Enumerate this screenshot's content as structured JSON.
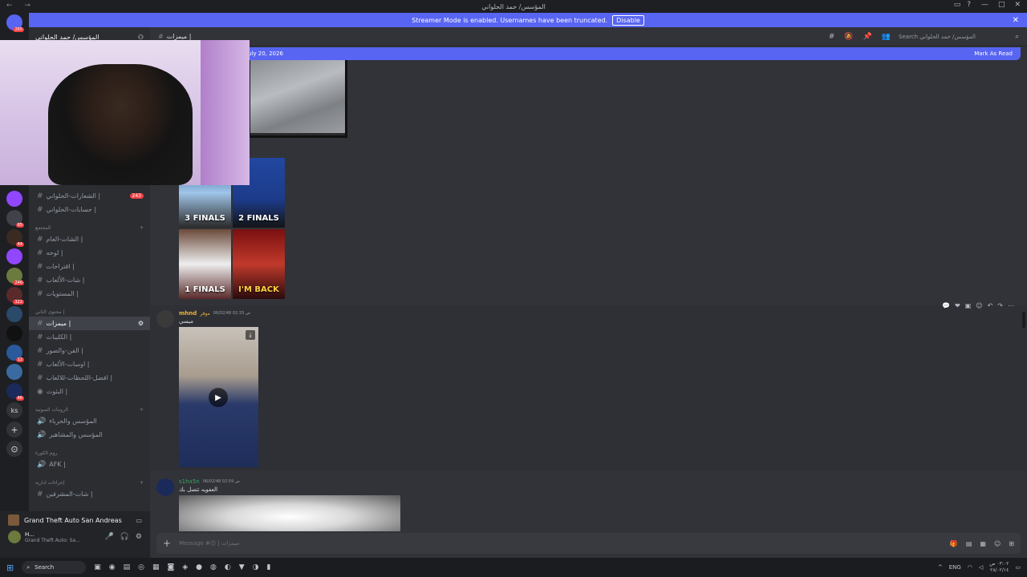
{
  "titlebar": {
    "title": "المؤسس/ حمد الحلواني",
    "nav": "← →"
  },
  "streamer_banner": {
    "text": "Streamer Mode is enabled. Usernames have been truncated.",
    "button": "Disable"
  },
  "server_list": {
    "home_badge": "265",
    "badges": [
      "65",
      "44",
      "246",
      "322",
      "12",
      "46"
    ],
    "text_server": "ks"
  },
  "sidebar": {
    "server_name": "المؤسس/ حمد الحلواني",
    "channels": [
      {
        "name": "الشعارات-الحلواني |",
        "count": "243"
      },
      {
        "name": "حسابات-الحلواني |"
      },
      {
        "category": "المجتمع"
      },
      {
        "name": "الشات-العام |"
      },
      {
        "name": "لوحه |"
      },
      {
        "name": "اقتراحات |"
      },
      {
        "name": "شات-الألعاب |"
      },
      {
        "name": "المستويات |"
      },
      {
        "category": "محتوى الثاني |"
      },
      {
        "name": "ميمزات |",
        "active": true
      },
      {
        "name": "الكليبات |"
      },
      {
        "name": "الفن-والصور |"
      },
      {
        "name": "اوسات-الألعاب |"
      },
      {
        "name": "افضل-اللحظات-للالعاب |"
      },
      {
        "name": "البثوث |"
      },
      {
        "category": "الرومات الصوتية"
      },
      {
        "name": "المؤسس والحرباء",
        "voice": true
      },
      {
        "name": "المؤسس والمشاهير",
        "voice": true
      },
      {
        "category": "روم الكورة"
      },
      {
        "name": "AFK |",
        "voice": true
      },
      {
        "category": "إجراءات ادارية"
      },
      {
        "name": "شات-المشرفين |"
      }
    ]
  },
  "user_panel": {
    "game": "Grand Theft Auto San Andreas",
    "user_name": "H...",
    "user_status": "Grand Theft Auto: Sa..."
  },
  "chat_header": {
    "channel": "ميمزات |",
    "search_placeholder": "Search المؤسس/ حمد الحلواني"
  },
  "new_messages_bar": {
    "date": "uly 20, 2026",
    "action": "Mark As Read"
  },
  "meme_grid": [
    "3 FINALS",
    "2 FINALS",
    "1 FINALS",
    "I'M BACK"
  ],
  "messages": [
    {
      "author": "mhnd",
      "tag": "موقر",
      "time": "06/02/48 02:33 ص",
      "text": "ميسي"
    },
    {
      "author": "s1ha5n",
      "time": "06/02/48 02:59 ص",
      "text": "العفويه تتصل بك"
    }
  ],
  "composer": {
    "placeholder": "Message #😉 | ميمزات"
  },
  "taskbar": {
    "search": "Search",
    "lang": "ENG",
    "time": "٠٣:٠٢ ص",
    "date": "٢٨/٠٢/١٤"
  },
  "colors": {
    "accent": "#5865f2",
    "background": "#313338",
    "sidebar": "#2b2d31"
  }
}
